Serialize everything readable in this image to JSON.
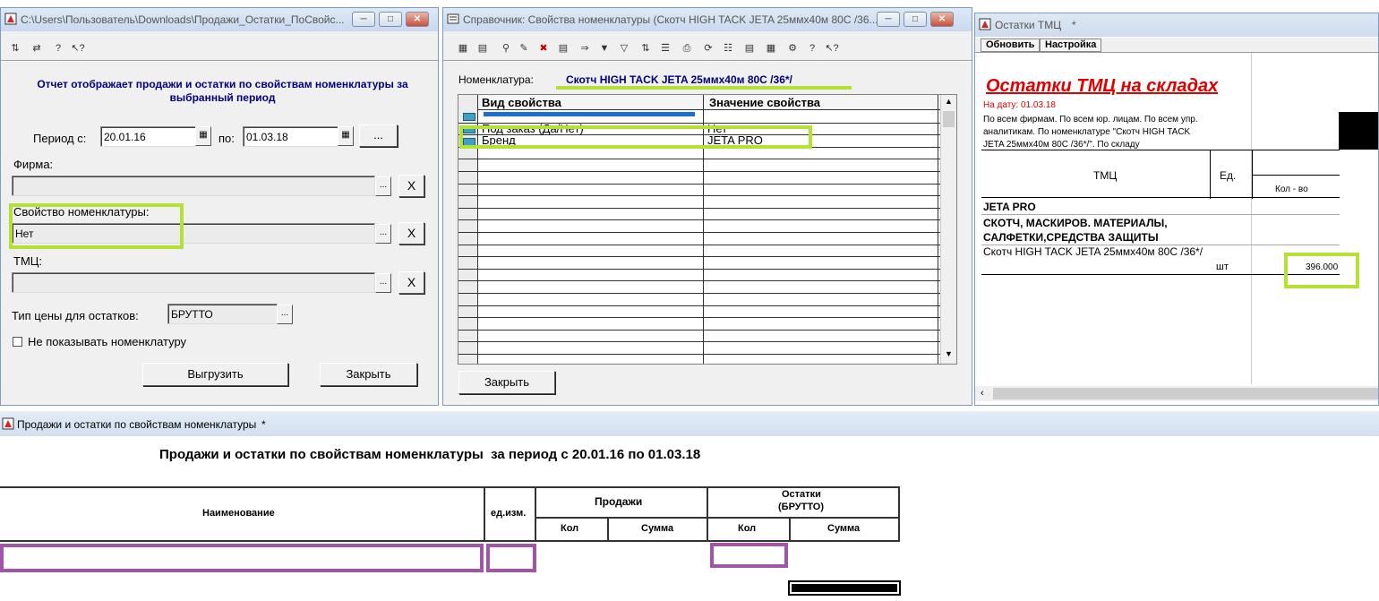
{
  "report_window": {
    "title": "C:\\Users\\Пользователь\\Downloads\\Продажи_Остатки_ПоСвойс...",
    "description": "Отчет отображает продажи и остатки по свойствам номенклатуры за выбранный период",
    "period_from_label": "Период с:",
    "period_from": "20.01.16",
    "period_to_label": "по:",
    "period_to": "01.03.18",
    "period_button": "...",
    "firm_label": "Фирма:",
    "firm_value": "",
    "property_label": "Свойство номенклатуры:",
    "property_value": "Нет",
    "tmc_label": "ТМЦ:",
    "tmc_value": "",
    "price_type_label": "Тип цены для остатков:",
    "price_type_value": "БРУТТО",
    "hide_nomenclature_label": "Не показывать номенклатуру",
    "export_button": "Выгрузить",
    "close_button": "Закрыть",
    "ellipsis": "...",
    "clear": "X"
  },
  "properties_window": {
    "title": "Справочник: Свойства номенклатуры (Скотч HIGH TACK JETA 25ммх40м 80С /36...",
    "nomenclature_label": "Номенклатура:",
    "nomenclature_value": "Скотч HIGH TACK JETA 25ммх40м 80С /36*/",
    "columns": [
      "Вид свойства",
      "Значение свойства"
    ],
    "rows": [
      {
        "kind": "",
        "value": ""
      },
      {
        "kind": "Под заказ (Да/Нет)",
        "value": "Нет"
      },
      {
        "kind": "Бренд",
        "value": "JETA PRO"
      }
    ],
    "close_button": "Закрыть"
  },
  "stock_window": {
    "title": "Остатки ТМЦ",
    "modified_mark": "*",
    "tab_refresh": "Обновить",
    "tab_settings": "Настройка",
    "heading": "Остатки ТМЦ на складах",
    "date_line": "На дату: 01.03.18",
    "filter_text": "По всем фирмам. По всем юр. лицам. По всем упр. аналитикам. По номенклатуре \"Скотч HIGH TACK JETA 25ммх40м 80С /36*/\". По складу",
    "col_tmc": "ТМЦ",
    "col_unit": "Ед.",
    "col_qty": "Кол - во",
    "group_brand": "JETA PRO",
    "group_category": "СКОТЧ, МАСКИРОВ. МАТЕРИАЛЫ, САЛФЕТКИ,СРЕДСТВА ЗАЩИТЫ",
    "item_name": "Скотч HIGH TACK JETA 25ммх40м 80С /36*/",
    "item_unit": "шт",
    "item_qty": "396.000"
  },
  "sales_report": {
    "title": "Продажи и остатки по свойствам номенклатуры",
    "modified_mark": "*",
    "heading": "Продажи и остатки по свойствам номенклатуры  за период с 20.01.16 по 01.03.18",
    "col_name": "Наименование",
    "col_unit": "ед.изм.",
    "col_sales": "Продажи",
    "col_stock_line1": "Остатки",
    "col_stock_line2": "(БРУТТО)",
    "col_qty": "Кол",
    "col_sum": "Сумма"
  },
  "colors": {
    "highlight_green": "#b5e035",
    "highlight_purple": "#a154a8",
    "heading_red": "#e00000",
    "label_navy": "#000080"
  }
}
